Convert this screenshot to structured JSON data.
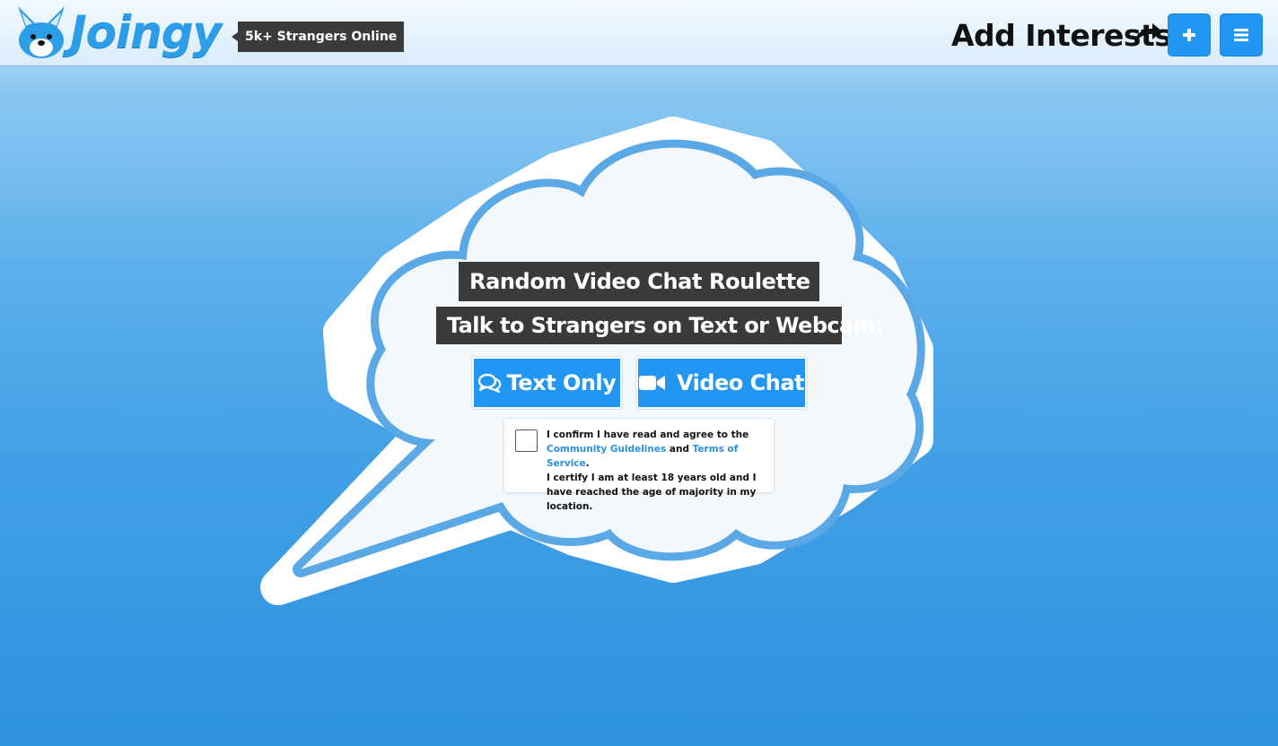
{
  "header": {
    "brand": "Joingy",
    "online_badge": "5k+ Strangers Online",
    "add_interests_label": "Add Interests",
    "add_button_icon": "plus-icon",
    "menu_button_icon": "hamburger-menu-icon"
  },
  "main": {
    "title_line1": "Random Video Chat Roulette",
    "title_line2": "Talk to Strangers on Text or Webcam:",
    "buttons": {
      "text_only": "Text Only",
      "video_chat": "Video Chat"
    },
    "agreement": {
      "part1": "I confirm I have read and agree to the",
      "community_guidelines": "Community Guidelines",
      "and": "and",
      "terms_of_service": "Terms of Service",
      "period": ".",
      "part2": "I certify I am at least 18 years old and I have reached the age of majority in my location.",
      "checked": false
    }
  },
  "colors": {
    "accent": "#2196f3",
    "dark_badge": "#3a3a3a",
    "cloud_outline": "#5aa9e6",
    "cloud_fill": "#f3f8fc"
  }
}
